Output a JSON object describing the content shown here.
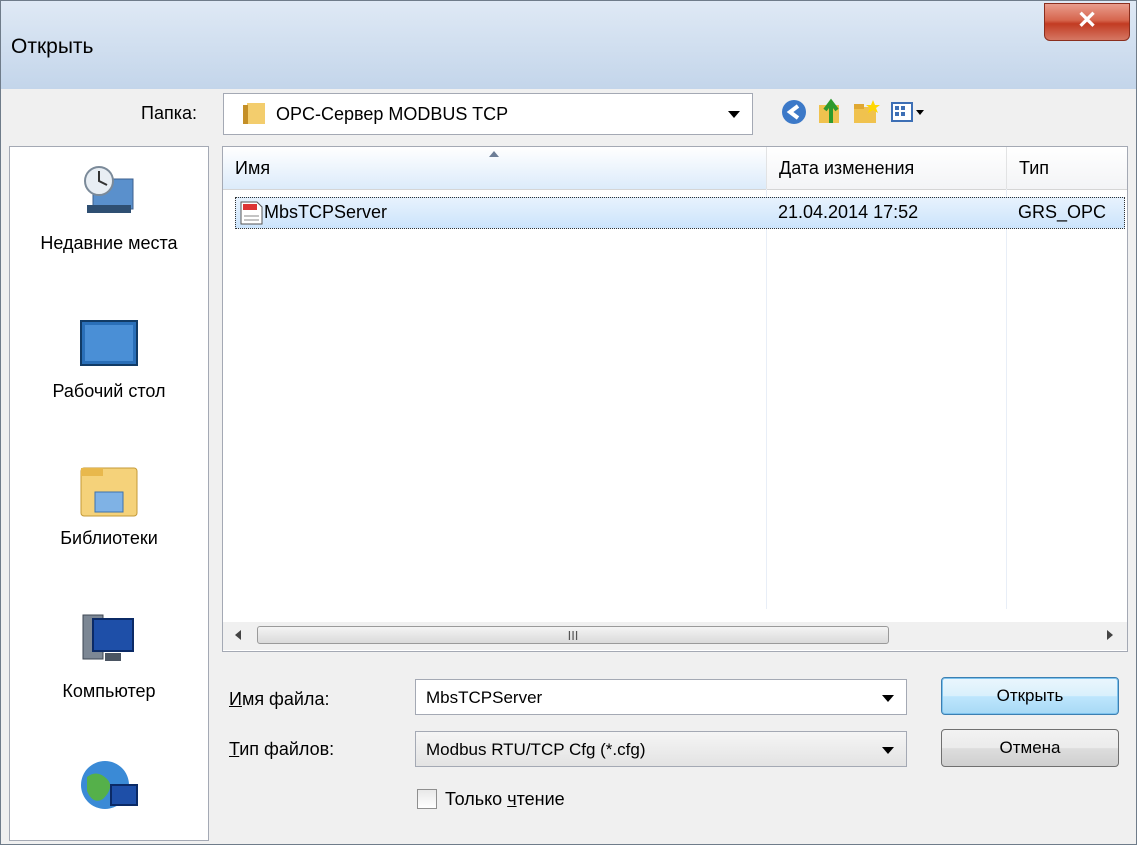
{
  "window": {
    "title": "Открыть"
  },
  "toolbar": {
    "folder_label": "Папка:",
    "folder_value": "OPC-Сервер MODBUS TCP"
  },
  "places": [
    {
      "label": "Недавние места",
      "icon": "recent-places-icon"
    },
    {
      "label": "Рабочий стол",
      "icon": "desktop-icon"
    },
    {
      "label": "Библиотеки",
      "icon": "libraries-icon"
    },
    {
      "label": "Компьютер",
      "icon": "computer-icon"
    },
    {
      "label": "",
      "icon": "network-icon"
    }
  ],
  "file_list": {
    "columns": [
      "Имя",
      "Дата изменения",
      "Тип"
    ],
    "rows": [
      {
        "name": "MbsTCPServer",
        "date": "21.04.2014 17:52",
        "type": "GRS_OPC"
      }
    ],
    "scroll_grip": "III"
  },
  "form": {
    "filename_label": "Имя файла:",
    "filename_value": "MbsTCPServer",
    "filetype_label": "Тип файлов:",
    "filetype_value": "Modbus RTU/TCP Cfg (*.cfg)",
    "readonly_label": "Только чтение",
    "open_label": "Открыть",
    "cancel_label": "Отмена"
  },
  "colors": {
    "title_gradient_top": "#dfe9f5",
    "close_red": "#c23b22",
    "selection": "#cce4fc"
  }
}
